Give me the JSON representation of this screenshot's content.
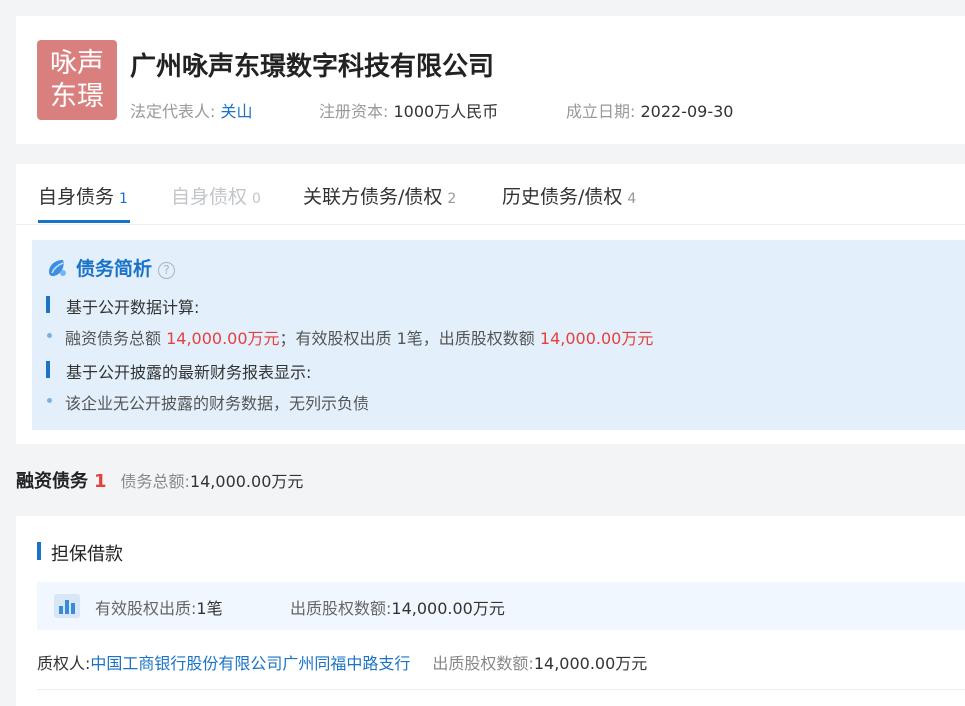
{
  "company": {
    "logo_line1": "咏声",
    "logo_line2": "东璟",
    "name": "广州咏声东璟数字科技有限公司",
    "legal_rep_label": "法定代表人:",
    "legal_rep": "关山",
    "capital_label": "注册资本:",
    "capital": "1000万人民币",
    "founded_label": "成立日期:",
    "founded": "2022-09-30"
  },
  "tabs": [
    {
      "label": "自身债务",
      "count": "1",
      "state": "active"
    },
    {
      "label": "自身债权",
      "count": "0",
      "state": "disabled"
    },
    {
      "label": "关联方债务/债权",
      "count": "2",
      "state": "normal"
    },
    {
      "label": "历史债务/债权",
      "count": "4",
      "state": "normal"
    }
  ],
  "summary": {
    "title": "债务简析",
    "help": "?",
    "section1": "基于公开数据计算:",
    "s1_a": "融资债务总额 ",
    "s1_b": "14,000.00万元",
    "s1_c": "；有效股权出质 1笔，出质股权数额 ",
    "s1_d": "14,000.00万元",
    "section2": "基于公开披露的最新财务报表显示:",
    "s2": "该企业无公开披露的财务数据，无列示负债"
  },
  "financing": {
    "title": "融资债务",
    "count": "1",
    "total_label": "债务总额:",
    "total": "14,000.00万元"
  },
  "guarantee": {
    "title": "担保借款",
    "equity_label": "有效股权出质:",
    "equity_count": "1笔",
    "amount_label": "出质股权数额:",
    "amount": "14,000.00万元",
    "pledgee_label": "质权人:",
    "pledgee": "中国工商银行股份有限公司广州同福中路支行",
    "pledge_amount_label": "出质股权数额:",
    "pledge_amount": "14,000.00万元"
  },
  "colors": {
    "accent": "#1a73c7",
    "alert": "#e5403d",
    "logo_bg": "#d9807f",
    "summary_bg": "#e3f0fc"
  }
}
